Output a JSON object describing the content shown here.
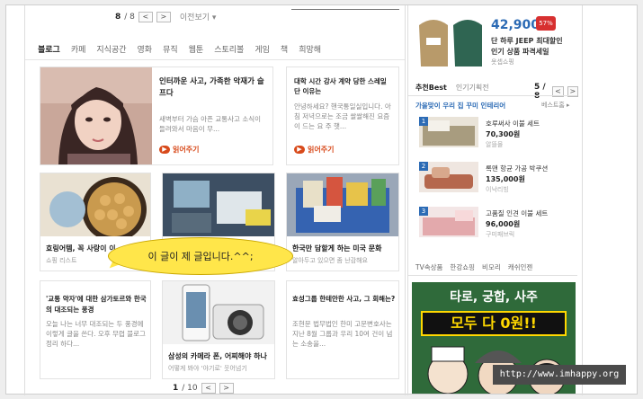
{
  "pager_top": {
    "page": "8",
    "total": "/ 8",
    "prev": "<",
    "next": ">",
    "label": "이전보기 ▾"
  },
  "tabs": [
    "블로그",
    "카페",
    "지식공간",
    "영화",
    "뮤직",
    "웹툰",
    "스토리볼",
    "게임",
    "책",
    "희망해"
  ],
  "cards": [
    {
      "title": "인터까운 사고, 가족한 악재가 슬프다",
      "summary": "새벽부터 가슴 아픈 교통사고 소식이 들려와서 마음이 무...",
      "more": "읽어주기"
    },
    {
      "title": "대학 시간 강사 계약 당한 스레일 단 이유는",
      "summary": "안녕하세요? 핸국통일실입니다. 아침 저녁으로는 조금 쌀쌀해진 요즘이 드는 요 주 햇...",
      "more": "읽어주기"
    }
  ],
  "grid": [
    {
      "title": "효링어템, 꼭 사랑이 이",
      "sub": "쇼핑 리스트"
    },
    {
      "title": "",
      "sub": ""
    },
    {
      "title": "한국만 담할게 하는 미국 문화",
      "sub": "알아두고 있으면 좀 난감해요"
    },
    {
      "title": "'교통 약자'에 대한 삼가토르와 한국의 대조되는 풍경",
      "sub": "오늘 나는 너무 대조되는 두 풍경에 이렇게 글을 쓴다. 오후 무렵 블로그 정리 하다..."
    },
    {
      "title": "삼성의 카메라 폰, 어찌해야 하나",
      "sub": "어떻게 봐야 '야기로' 웃어넘기"
    },
    {
      "title": "효성그룹 한테안한 사고, 그 회해는?",
      "sub": "조현문 법무법인 한미 고문변호사는 지난 8월 그룹과 우리 10여 건이 넘는 소송을..."
    }
  ],
  "bubble": "이 글이 제 글입니다.^^;",
  "pager_bottom": {
    "page": "1",
    "total": "/ 10",
    "prev": "<",
    "next": ">"
  },
  "ad": {
    "price": "42,900",
    "badge": "57%",
    "line1": "단 하루 JEEP 최대할인",
    "line2": "인기 상품 파격세일",
    "shop": "옷셉쇼핑"
  },
  "recommend": {
    "tab_active": "추천Best",
    "tab_other": "인기기획전",
    "page": "5 / 8",
    "subtitle": "가을맞이 우리 집 꾸미 인테리어",
    "more": "베스트홈 ▸",
    "items": [
      {
        "num": "1",
        "name": "호루써사 이불 세트",
        "price": "70,300원",
        "shop": "알뜰몰"
      },
      {
        "num": "2",
        "name": "록맨 항균 가공 박쿠션",
        "price": "135,000원",
        "shop": "이낙리빙"
      },
      {
        "num": "3",
        "name": "고품질 인견 이불 세트",
        "price": "96,000원",
        "shop": "구미패브릭"
      }
    ]
  },
  "links": [
    "TV속상품",
    "한강쇼핑",
    "비모리",
    "캐쉬인젠"
  ],
  "banner": {
    "line1": "타로, 궁합, 사주",
    "line2": "모두 다 0원!!"
  },
  "watermark": "http://www.imhappy.org",
  "colors": {
    "accent": "#d84a1b",
    "link_blue": "#2c6bb5",
    "bubble": "#ffe64a"
  }
}
